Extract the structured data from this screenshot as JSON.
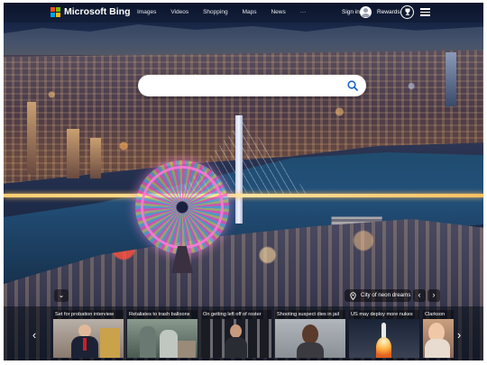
{
  "header": {
    "brand": "Microsoft Bing",
    "nav": [
      "Images",
      "Videos",
      "Shopping",
      "Maps",
      "News",
      "···"
    ],
    "signin": "Sign in",
    "rewards": "Rewards"
  },
  "search": {
    "value": "",
    "placeholder": ""
  },
  "image": {
    "location": "City of neon dreams"
  },
  "news": [
    {
      "headline": "Set for probation interview",
      "thumb": "person-at-podium"
    },
    {
      "headline": "Retaliates to trash balloons",
      "thumb": "people-inspecting-debris"
    },
    {
      "headline": "On getting left off of roster",
      "thumb": "athlete-portrait"
    },
    {
      "headline": "Shooting suspect dies in jail",
      "thumb": "mugshot"
    },
    {
      "headline": "US may deploy more nukes",
      "thumb": "missile-launch"
    },
    {
      "headline": "Clarkson",
      "thumb": "woman-portrait"
    }
  ],
  "colors": {
    "logo": [
      "#f25022",
      "#7fba00",
      "#00a4ef",
      "#ffb900"
    ],
    "search_icon": "#1a66c8"
  }
}
